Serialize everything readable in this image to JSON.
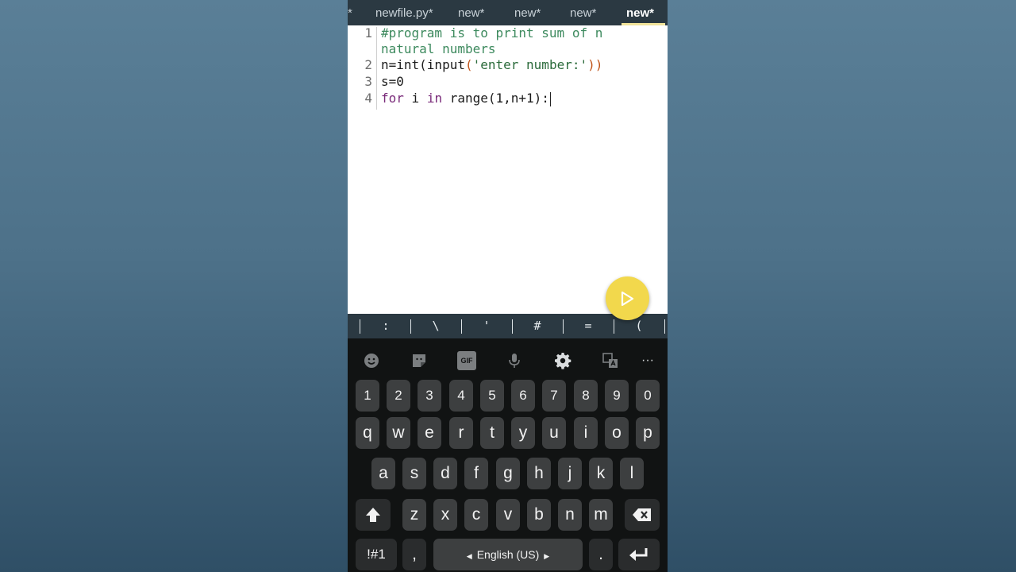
{
  "tabs": [
    {
      "label": "*",
      "active": false
    },
    {
      "label": "newfile.py*",
      "active": false
    },
    {
      "label": "new*",
      "active": false
    },
    {
      "label": "new*",
      "active": false
    },
    {
      "label": "new*",
      "active": false
    },
    {
      "label": "new*",
      "active": true
    }
  ],
  "editor": {
    "lines": [
      {
        "number": "1",
        "segments": [
          {
            "t": "#program is to print sum of n",
            "c": "comment"
          }
        ]
      },
      {
        "number": "",
        "segments": [
          {
            "t": "natural numbers",
            "c": "comment"
          }
        ]
      },
      {
        "number": "2",
        "segments": [
          {
            "t": "n=int(input",
            "c": "default"
          },
          {
            "t": "(",
            "c": "paren"
          },
          {
            "t": "'enter number:'",
            "c": "str"
          },
          {
            "t": "))",
            "c": "paren"
          }
        ]
      },
      {
        "number": "3",
        "segments": [
          {
            "t": "s=0",
            "c": "default"
          }
        ]
      },
      {
        "number": "4",
        "segments": [
          {
            "t": "for",
            "c": "kw"
          },
          {
            "t": " i ",
            "c": "default"
          },
          {
            "t": "in",
            "c": "kw"
          },
          {
            "t": " range(1,n+1):",
            "c": "default"
          }
        ]
      }
    ]
  },
  "run_button": {
    "icon": "play-icon",
    "color": "#f2d84c"
  },
  "symbols": [
    ":",
    "\\",
    "'",
    "#",
    "=",
    "("
  ],
  "keyboard": {
    "toolbar": [
      "emoji-icon",
      "sticker-icon",
      "gif-icon",
      "mic-icon",
      "settings-icon",
      "translate-icon",
      "more-icon"
    ],
    "gif_label": "GIF",
    "more_label": "···",
    "row_numbers": [
      "1",
      "2",
      "3",
      "4",
      "5",
      "6",
      "7",
      "8",
      "9",
      "0"
    ],
    "row1": [
      "q",
      "w",
      "e",
      "r",
      "t",
      "y",
      "u",
      "i",
      "o",
      "p"
    ],
    "row2": [
      "a",
      "s",
      "d",
      "f",
      "g",
      "h",
      "j",
      "k",
      "l"
    ],
    "row3": [
      "z",
      "x",
      "c",
      "v",
      "b",
      "n",
      "m"
    ],
    "symbols_key": "!#1",
    "comma_key": ",",
    "space_label": "English (US)",
    "period_key": ".",
    "shift_icon": "shift-icon",
    "backspace_icon": "backspace-icon",
    "enter_icon": "enter-icon"
  },
  "colors": {
    "tab_bar": "#2b3942",
    "accent_underline": "#f1e39a",
    "comment": "#3d8a5e",
    "keyword": "#7a2b7a",
    "keyboard_bg": "#111313",
    "key_bg": "#3d3f40"
  }
}
